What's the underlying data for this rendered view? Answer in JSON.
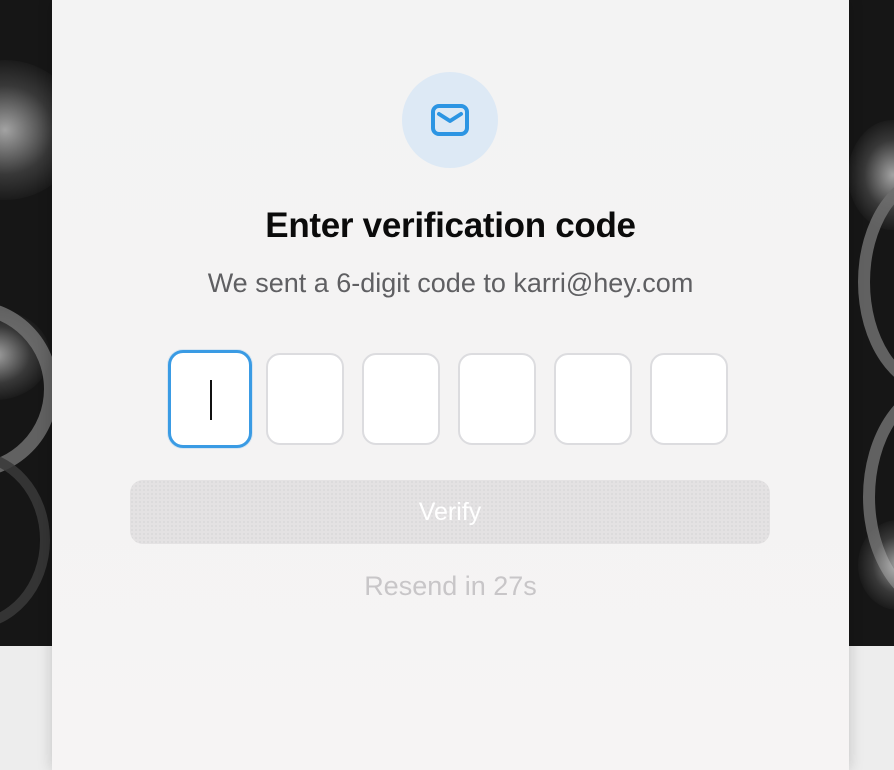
{
  "modal": {
    "icon": "mail-icon",
    "title": "Enter verification code",
    "subtitle": "We sent a 6-digit code to karri@hey.com",
    "code_digits": [
      "",
      "",
      "",
      "",
      "",
      ""
    ],
    "active_digit_index": 0,
    "verify_label": "Verify",
    "resend_text": "Resend in 27s"
  },
  "colors": {
    "accent": "#3a9be4",
    "icon_circle_bg": "#dde9f5",
    "title": "#0b0b0b",
    "subtitle": "#5f5f62",
    "button_disabled_bg": "#e4e2e3",
    "resend_text": "#c8c6c8",
    "card_bg": "#f3f3f3"
  }
}
